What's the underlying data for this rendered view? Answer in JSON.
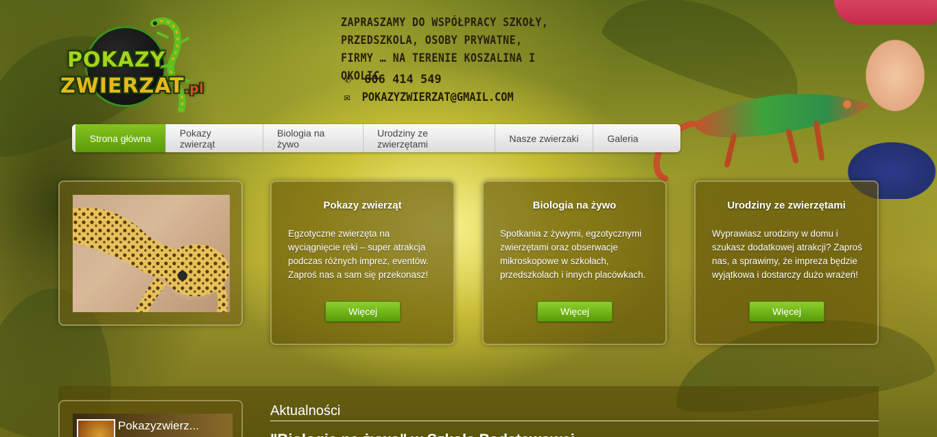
{
  "logo": {
    "line1": "POKAZY",
    "line2": "ZWIERZAT",
    "suffix": ".pl"
  },
  "header": {
    "tagline": "Zapraszamy do współpracy szkoły, przedszkola, osoby prywatne, firmy … na terenie Koszalina i okolic",
    "phone": "606 414 549",
    "email": "POKAZYZWIERZAT@GMAIL.COM",
    "phone_icon": "phone-icon",
    "email_icon": "envelope-icon"
  },
  "nav": {
    "items": [
      {
        "label": "Strona główna",
        "active": true
      },
      {
        "label": "Pokazy zwierząt",
        "active": false
      },
      {
        "label": "Biologia na żywo",
        "active": false
      },
      {
        "label": "Urodziny ze zwierzętami",
        "active": false
      },
      {
        "label": "Nasze zwierzaki",
        "active": false
      },
      {
        "label": "Galeria",
        "active": false
      }
    ]
  },
  "cards": [
    {
      "title": "Pokazy zwierząt",
      "text": "Egzotyczne zwierzęta na wyciągnięcie ręki – super atrakcja podczas różnych imprez, eventów. Zaproś nas a sam się przekonasz!",
      "button": "Więcej"
    },
    {
      "title": "Biologia na żywo",
      "text": "Spotkania z żywymi, egzotycznymi zwierzętami oraz obserwacje mikroskopowe w szkołach, przedszkolach i innych placówkach.",
      "button": "Więcej"
    },
    {
      "title": "Urodziny ze zwierzętami",
      "text": "Wyprawiasz urodziny w domu i szukasz dodatkowej atrakcji? Zaproś nas, a sprawimy, że impreza będzie wyjątkowa i dostarczy dużo wrażeń!",
      "button": "Więcej"
    }
  ],
  "facebook": {
    "name": "Pokazyzwierz..."
  },
  "news": {
    "section_title": "Aktualności",
    "headline": "\"Biologia na żywo\" w Szkole Podstawowej ..."
  },
  "colors": {
    "accent_green": "#6aab12",
    "nav_bg": "#e8e8e8",
    "header_text": "#2a1e0c"
  }
}
